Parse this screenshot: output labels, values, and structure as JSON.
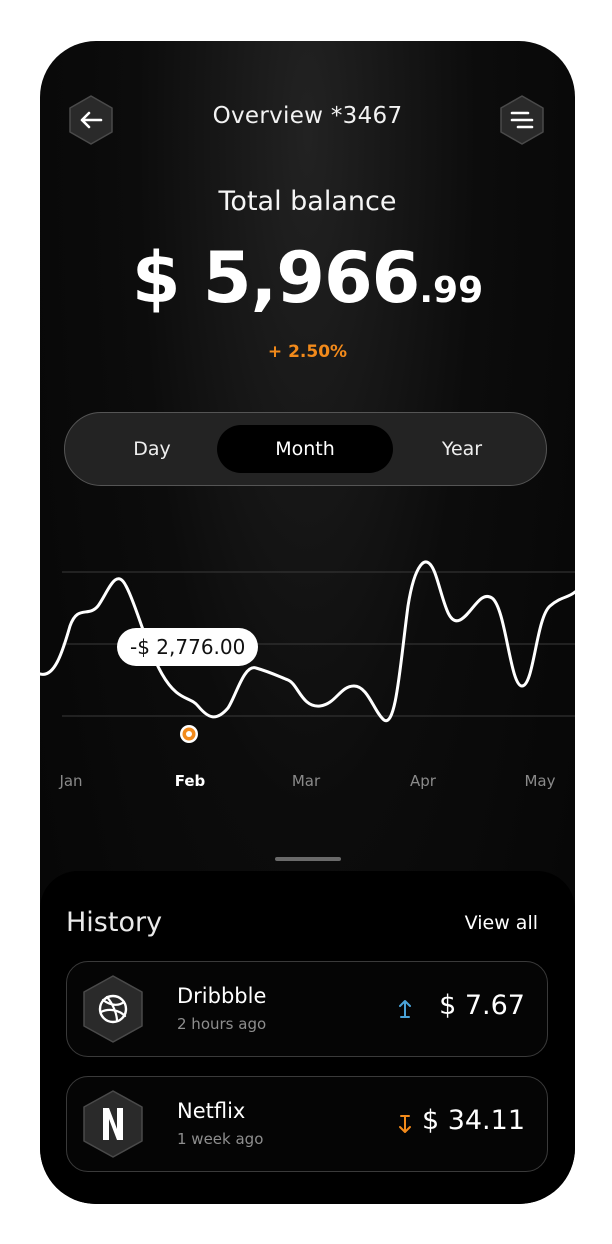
{
  "header": {
    "back_icon": "arrow-left-icon",
    "title": "Overview *3467",
    "menu_icon": "filter-lines-icon"
  },
  "balance": {
    "label": "Total balance",
    "amount_main": "$ 5,966",
    "amount_cents": ".99",
    "change": "+ 2.50%"
  },
  "period_tabs": [
    {
      "label": "Day",
      "selected": false
    },
    {
      "label": "Month",
      "selected": true
    },
    {
      "label": "Year",
      "selected": false
    }
  ],
  "chart": {
    "tooltip": "-$ 2,776.00",
    "x_labels": [
      "Jan",
      "Feb",
      "Mar",
      "Apr",
      "May"
    ],
    "active_label": "Feb",
    "line_color": "#ffffff",
    "marker_color": "#f28a1b"
  },
  "history": {
    "title": "History",
    "view_all": "View all",
    "items": [
      {
        "name": "Dribbble",
        "time": "2 hours ago",
        "amount": "$ 7.67",
        "direction": "up",
        "arrow_color": "#4aa3d8",
        "icon": "dribbble-icon"
      },
      {
        "name": "Netflix",
        "time": "1 week ago",
        "amount": "$ 34.11",
        "direction": "down",
        "arrow_color": "#f28a1b",
        "icon": "netflix-icon"
      }
    ]
  },
  "colors": {
    "accent": "#f28a1b",
    "background": "#050505",
    "up_arrow": "#4aa3d8"
  }
}
